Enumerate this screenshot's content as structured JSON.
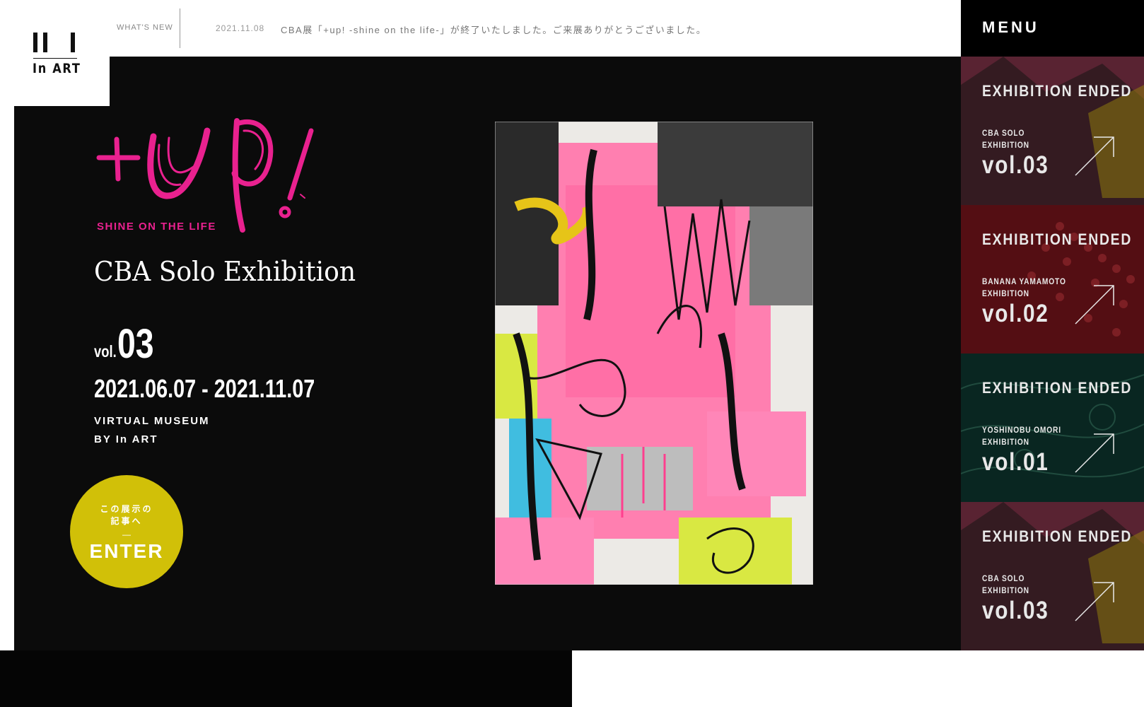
{
  "brand": {
    "name": "In ART"
  },
  "topbar": {
    "label": "WHAT'S NEW",
    "news_date": "2021.11.08",
    "news_text": "CBA展「+up! -shine on the life-」が終了いたしました。ご来展ありがとうございました。"
  },
  "menu": {
    "label": "MENU"
  },
  "hero": {
    "logo_text": "+UP!",
    "tagline": "SHINE ON THE LIFE",
    "title": "CBA Solo Exhibition",
    "vol_prefix": "vol.",
    "vol_number": "03",
    "dates": "2021.06.07 - 2021.11.07",
    "venue_line1": "VIRTUAL MUSEUM",
    "venue_line2": "BY In ART"
  },
  "enter": {
    "jp_line1": "この展示の",
    "jp_line2": "記事へ",
    "dash": "—",
    "label": "ENTER"
  },
  "exhibitions": [
    {
      "status": "EXHIBITION ENDED",
      "name_line1": "CBA SOLO",
      "name_line2": "EXHIBITION",
      "vol": "vol.03",
      "color": "#6b2a3a"
    },
    {
      "status": "EXHIBITION ENDED",
      "name_line1": "BANANA YAMAMOTO",
      "name_line2": "EXHIBITION",
      "vol": "vol.02",
      "color": "#7a1a20"
    },
    {
      "status": "EXHIBITION ENDED",
      "name_line1": "YOSHINOBU OMORI",
      "name_line2": "EXHIBITION",
      "vol": "vol.01",
      "color": "#0f3a33"
    },
    {
      "status": "EXHIBITION ENDED",
      "name_line1": "CBA SOLO",
      "name_line2": "EXHIBITION",
      "vol": "vol.03",
      "color": "#6b2a3a"
    }
  ],
  "colors": {
    "accent_pink": "#e9218f",
    "enter_yellow": "#d1c008",
    "main_bg": "#0b0b0b"
  }
}
